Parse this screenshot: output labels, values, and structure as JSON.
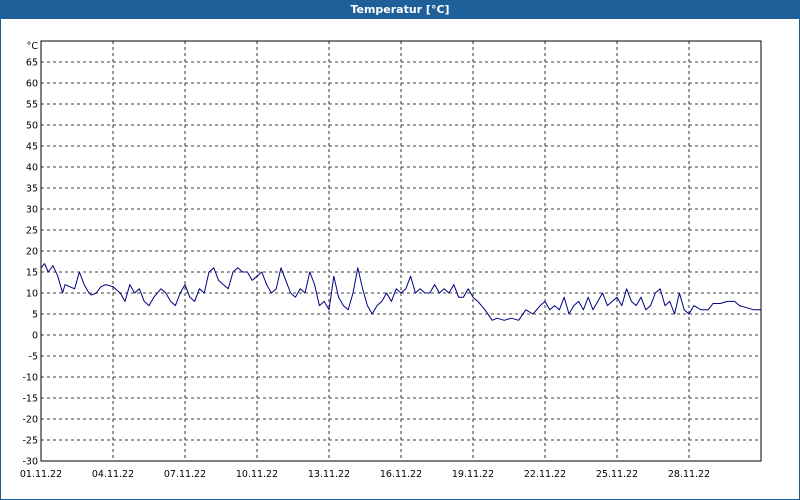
{
  "window": {
    "title": "Temperatur [°C]"
  },
  "chart_data": {
    "type": "line",
    "title": "Temperatur [°C]",
    "ylabel": "°C",
    "ylim": [
      -30,
      70
    ],
    "y_ticks": [
      -30,
      -25,
      -20,
      -15,
      -10,
      -5,
      0,
      5,
      10,
      15,
      20,
      25,
      30,
      35,
      40,
      45,
      50,
      55,
      60,
      65
    ],
    "xlim": [
      0,
      30
    ],
    "x_ticks": [
      {
        "x": 0,
        "label": "01.11.22"
      },
      {
        "x": 3,
        "label": "04.11.22"
      },
      {
        "x": 6,
        "label": "07.11.22"
      },
      {
        "x": 9,
        "label": "10.11.22"
      },
      {
        "x": 12,
        "label": "13.11.22"
      },
      {
        "x": 15,
        "label": "16.11.22"
      },
      {
        "x": 18,
        "label": "19.11.22"
      },
      {
        "x": 21,
        "label": "22.11.22"
      },
      {
        "x": 24,
        "label": "25.11.22"
      },
      {
        "x": 27,
        "label": "28.11.22"
      }
    ],
    "grid": true,
    "line_color": "#000080",
    "series": [
      {
        "name": "",
        "x": [
          0,
          0.15,
          0.3,
          0.5,
          0.7,
          0.9,
          1.0,
          1.2,
          1.4,
          1.6,
          1.8,
          2.0,
          2.1,
          2.3,
          2.5,
          2.7,
          3.0,
          3.3,
          3.5,
          3.7,
          3.9,
          4.1,
          4.3,
          4.5,
          4.7,
          5.0,
          5.2,
          5.4,
          5.6,
          5.8,
          6.0,
          6.2,
          6.4,
          6.6,
          6.8,
          7.0,
          7.2,
          7.4,
          7.6,
          7.8,
          8.0,
          8.2,
          8.4,
          8.6,
          8.8,
          9.0,
          9.2,
          9.4,
          9.6,
          9.8,
          10.0,
          10.2,
          10.4,
          10.6,
          10.8,
          11.0,
          11.2,
          11.4,
          11.6,
          11.8,
          12.0,
          12.2,
          12.4,
          12.6,
          12.8,
          13.0,
          13.2,
          13.4,
          13.6,
          13.8,
          14.0,
          14.2,
          14.4,
          14.6,
          14.8,
          15.0,
          15.2,
          15.4,
          15.6,
          15.8,
          16.0,
          16.2,
          16.4,
          16.6,
          16.8,
          17.0,
          17.2,
          17.4,
          17.6,
          17.8,
          18.0,
          18.2,
          18.5,
          18.8,
          19.0,
          19.3,
          19.6,
          19.9,
          20.2,
          20.5,
          20.8,
          21.0,
          21.2,
          21.4,
          21.6,
          21.8,
          22.0,
          22.2,
          22.4,
          22.6,
          22.8,
          23.0,
          23.2,
          23.4,
          23.6,
          23.8,
          24.0,
          24.2,
          24.4,
          24.6,
          24.8,
          25.0,
          25.2,
          25.4,
          25.6,
          25.8,
          26.0,
          26.2,
          26.4,
          26.6,
          26.8,
          27.0,
          27.2,
          27.5,
          27.8,
          28.0,
          28.3,
          28.6,
          28.9,
          29.1,
          29.4,
          29.7,
          30.0
        ],
        "values": [
          16,
          17,
          15,
          16.5,
          14,
          10,
          12,
          11.5,
          11,
          15,
          12,
          10,
          9.5,
          10,
          11.5,
          12,
          11.5,
          10,
          8,
          12,
          10,
          11,
          8,
          7,
          9,
          11,
          10,
          8,
          7,
          10,
          12,
          9,
          8,
          11,
          10,
          15,
          16,
          13,
          12,
          11,
          15,
          16,
          15,
          15,
          13,
          14,
          15,
          12,
          10,
          11,
          16,
          13,
          10,
          9,
          11,
          10,
          15,
          12,
          7,
          8,
          6,
          14,
          9,
          7,
          6,
          10,
          16,
          11,
          7,
          5,
          7,
          8,
          10,
          8,
          11,
          10,
          11,
          14,
          10,
          11,
          10,
          10,
          12,
          10,
          11,
          10,
          12,
          9,
          9,
          11,
          9,
          8,
          6,
          3.5,
          4,
          3.5,
          4,
          3.5,
          6,
          5,
          7,
          8,
          6,
          7,
          6,
          9,
          5,
          7,
          8,
          6,
          9,
          6,
          8,
          10,
          7,
          8,
          9,
          7,
          11,
          8,
          7,
          9,
          6,
          7,
          10,
          11,
          7,
          8,
          5,
          10,
          6,
          5,
          7,
          6,
          6,
          7.5,
          7.5,
          8,
          8,
          7,
          6.5,
          6,
          6
        ]
      }
    ]
  }
}
